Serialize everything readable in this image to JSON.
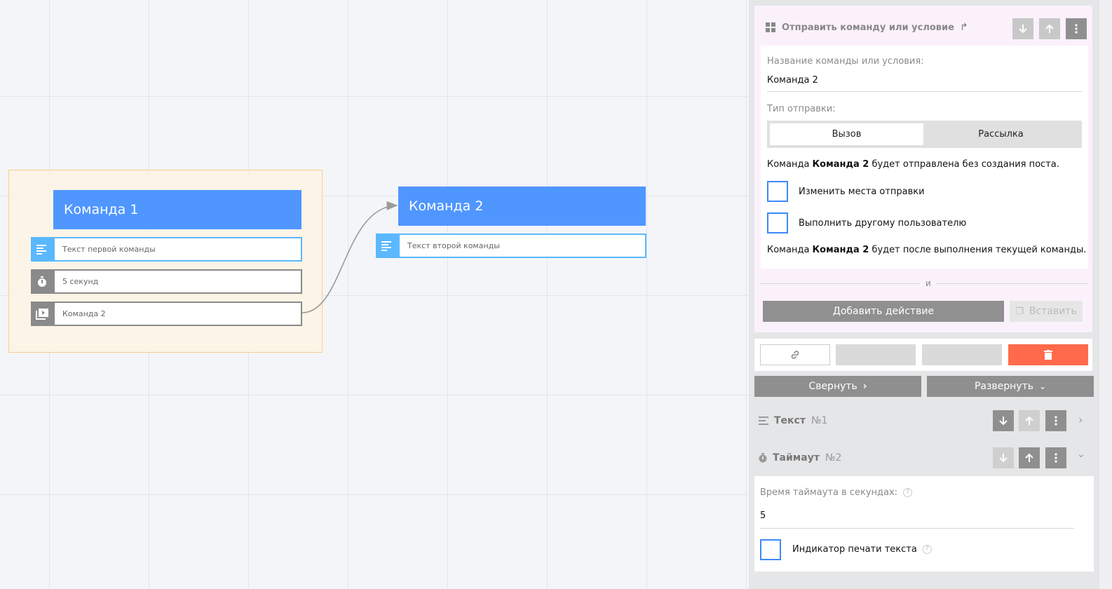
{
  "canvas": {
    "node1": {
      "title": "Команда 1",
      "rows": [
        {
          "icon": "text-lines-icon",
          "text": "Текст первой команды"
        },
        {
          "icon": "timer-icon",
          "text": "5 секунд"
        },
        {
          "icon": "play-command-icon",
          "text": "Команда 2"
        }
      ]
    },
    "node2": {
      "title": "Команда 2",
      "rows": [
        {
          "icon": "text-lines-icon",
          "text": "Текст второй команды"
        }
      ]
    }
  },
  "panel": {
    "title": "Отправить команду или условие",
    "name_label": "Название команды или условия:",
    "name_value": "Команда 2",
    "send_type_label": "Тип отправки:",
    "send_type_options": [
      "Вызов",
      "Рассылка"
    ],
    "send_type_selected": "Вызов",
    "info1_prefix": "Команда ",
    "info1_bold": "Команда 2",
    "info1_suffix": " будет отправлена без создания поста.",
    "checkbox_change_place": "Изменить места отправки",
    "checkbox_other_user": "Выполнить другому пользователю",
    "info2_prefix": "Команда ",
    "info2_bold": "Команда 2",
    "info2_suffix": " будет после выполнения текущей команды.",
    "and_label": "и",
    "add_action": "Добавить действие",
    "paste": "Вставить"
  },
  "collapse": "Свернуть",
  "expand": "Развернуть",
  "sections": [
    {
      "name": "Текст",
      "num": "№1"
    },
    {
      "name": "Таймаут",
      "num": "№2"
    }
  ],
  "timeout": {
    "label": "Время таймаута в секундах:",
    "value": "5",
    "typing_indicator": "Индикатор печати текста"
  },
  "colors": {
    "node_header": "#4f96ff",
    "text_row": "#5bb8ff",
    "gray_row": "#8a8a8a",
    "delete": "#ff6a4b",
    "checkbox": "#3d8af7"
  }
}
